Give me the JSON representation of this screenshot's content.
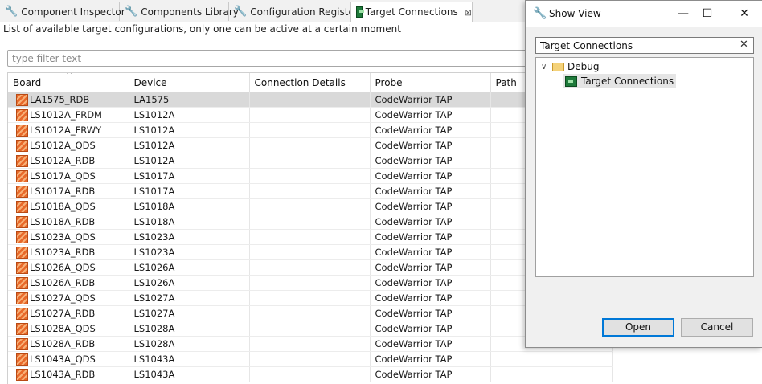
{
  "tabs": [
    {
      "label": "Component Inspector",
      "icon": "wrench-icon"
    },
    {
      "label": "Components Library",
      "icon": "wrench-icon"
    },
    {
      "label": "Configuration Registers",
      "icon": "wrench-icon"
    },
    {
      "label": "Target Connections",
      "icon": "chip-icon",
      "active": true
    }
  ],
  "view": {
    "description": "List of available target configurations, only one can be active at a certain moment",
    "filter_placeholder": "type filter text",
    "filter_value": ""
  },
  "table": {
    "columns": [
      "Board",
      "Device",
      "Connection Details",
      "Probe",
      "Path"
    ],
    "rows": [
      {
        "board": "LA1575_RDB",
        "device": "LA1575",
        "details": "",
        "probe": "CodeWarrior TAP",
        "path": "",
        "selected": true
      },
      {
        "board": "LS1012A_FRDM",
        "device": "LS1012A",
        "details": "",
        "probe": "CodeWarrior TAP",
        "path": ""
      },
      {
        "board": "LS1012A_FRWY",
        "device": "LS1012A",
        "details": "",
        "probe": "CodeWarrior TAP",
        "path": ""
      },
      {
        "board": "LS1012A_QDS",
        "device": "LS1012A",
        "details": "",
        "probe": "CodeWarrior TAP",
        "path": ""
      },
      {
        "board": "LS1012A_RDB",
        "device": "LS1012A",
        "details": "",
        "probe": "CodeWarrior TAP",
        "path": ""
      },
      {
        "board": "LS1017A_QDS",
        "device": "LS1017A",
        "details": "",
        "probe": "CodeWarrior TAP",
        "path": ""
      },
      {
        "board": "LS1017A_RDB",
        "device": "LS1017A",
        "details": "",
        "probe": "CodeWarrior TAP",
        "path": ""
      },
      {
        "board": "LS1018A_QDS",
        "device": "LS1018A",
        "details": "",
        "probe": "CodeWarrior TAP",
        "path": ""
      },
      {
        "board": "LS1018A_RDB",
        "device": "LS1018A",
        "details": "",
        "probe": "CodeWarrior TAP",
        "path": ""
      },
      {
        "board": "LS1023A_QDS",
        "device": "LS1023A",
        "details": "",
        "probe": "CodeWarrior TAP",
        "path": ""
      },
      {
        "board": "LS1023A_RDB",
        "device": "LS1023A",
        "details": "",
        "probe": "CodeWarrior TAP",
        "path": ""
      },
      {
        "board": "LS1026A_QDS",
        "device": "LS1026A",
        "details": "",
        "probe": "CodeWarrior TAP",
        "path": ""
      },
      {
        "board": "LS1026A_RDB",
        "device": "LS1026A",
        "details": "",
        "probe": "CodeWarrior TAP",
        "path": ""
      },
      {
        "board": "LS1027A_QDS",
        "device": "LS1027A",
        "details": "",
        "probe": "CodeWarrior TAP",
        "path": ""
      },
      {
        "board": "LS1027A_RDB",
        "device": "LS1027A",
        "details": "",
        "probe": "CodeWarrior TAP",
        "path": ""
      },
      {
        "board": "LS1028A_QDS",
        "device": "LS1028A",
        "details": "",
        "probe": "CodeWarrior TAP",
        "path": ""
      },
      {
        "board": "LS1028A_RDB",
        "device": "LS1028A",
        "details": "",
        "probe": "CodeWarrior TAP",
        "path": ""
      },
      {
        "board": "LS1043A_QDS",
        "device": "LS1043A",
        "details": "",
        "probe": "CodeWarrior TAP",
        "path": ""
      },
      {
        "board": "LS1043A_RDB",
        "device": "LS1043A",
        "details": "",
        "probe": "CodeWarrior TAP",
        "path": ""
      }
    ]
  },
  "dialog": {
    "title": "Show View",
    "search_value": "Target Connections",
    "tree": {
      "folder": "Debug",
      "item": "Target Connections"
    },
    "open_label": "Open",
    "cancel_label": "Cancel",
    "minimize_glyph": "—",
    "maximize_glyph": "☐",
    "close_glyph": "✕",
    "clear_glyph": "✕"
  },
  "colors": {
    "accent": "#0078d7",
    "selection": "#d9d9d9",
    "board_icon": "#e8692a",
    "chip_icon": "#1e7a3a"
  }
}
